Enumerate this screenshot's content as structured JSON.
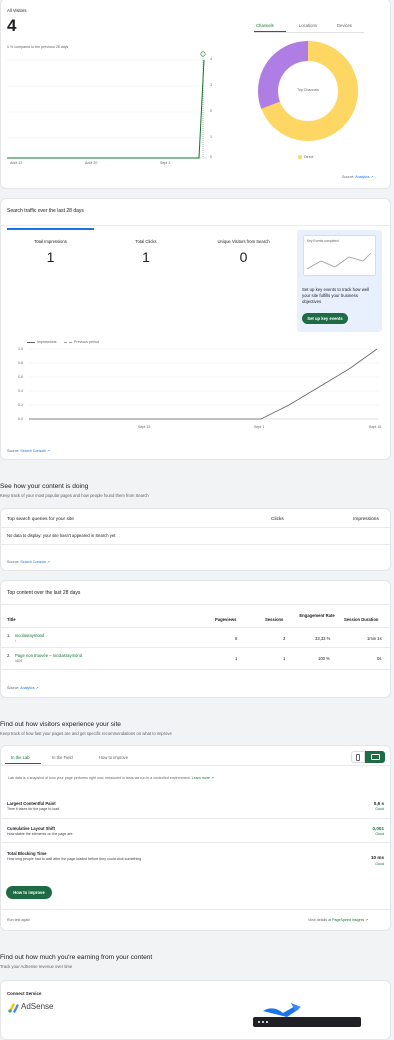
{
  "visitors": {
    "title": "All Visitors",
    "count": "4",
    "comparison": "0 % compared to the previous 28 days",
    "y_ticks": [
      "4",
      "3",
      "2",
      "1",
      "0"
    ],
    "x_ticks": [
      "Août 13",
      "Août 20",
      "Sept 3"
    ],
    "tabs": [
      "Channels",
      "Locations",
      "Devices"
    ],
    "donut_center": "Top Channels",
    "legend": "Direct",
    "source_label": "Source:",
    "source_link": "Analytics",
    "colors": {
      "direct": "#fdd663",
      "other": "#af7ee5",
      "line": "#137333",
      "accent": "#137333"
    }
  },
  "search_traffic": {
    "title": "Search traffic over the last 28 days",
    "metrics": [
      {
        "label": "Total Impressions",
        "value": "1"
      },
      {
        "label": "Total Clicks",
        "value": "1"
      },
      {
        "label": "Unique Visitors from Search",
        "value": "0"
      }
    ],
    "promo": {
      "thumb_title": "Key Events completed",
      "text": "Set up key events to track how well your site fulfills your business objectives",
      "button": "Set up key events"
    },
    "legend": [
      "Impressions",
      "Previous period"
    ],
    "y_ticks": [
      "1.0",
      "0.8",
      "0.6",
      "0.4",
      "0.2",
      "0.0"
    ],
    "x_ticks": [
      "Sept 15",
      "Sept 1",
      "Sept 15"
    ],
    "source_label": "Source:",
    "source_link": "Search Console"
  },
  "content_section": {
    "title": "See how your content is doing",
    "subtitle": "Keep track of your most popular pages and how people found them from Search"
  },
  "queries": {
    "title": "Top search queries for your site",
    "col_clicks": "Clicks",
    "col_impressions": "Impressions",
    "empty": "No data to display: your site hasn't appeared in Search yet",
    "source_label": "Source:",
    "source_link": "Search Console"
  },
  "top_content": {
    "title": "Top content over the last 28 days",
    "columns": [
      "Title",
      "Pageviews",
      "Sessions",
      "Engagement Rate",
      "Session Duration"
    ],
    "rows": [
      {
        "index": "1.",
        "title": "nicolasraymond",
        "path": "/",
        "pageviews": "6",
        "sessions": "3",
        "engagement": "33,33 %",
        "duration": "1min 1s"
      },
      {
        "index": "2.",
        "title": "Page non trouvée – nicolasraymond",
        "path": "/404",
        "pageviews": "1",
        "sessions": "1",
        "engagement": "100 %",
        "duration": "0s"
      }
    ],
    "source_label": "Source:",
    "source_link": "Analytics"
  },
  "experience": {
    "title": "Find out how visitors experience your site",
    "subtitle": "Keep track of how fast your pages are and get specific recommendations on what to improve",
    "tabs": [
      "In the Lab",
      "In the Field",
      "How to improve"
    ],
    "lab_text": "Lab data is a snapshot of how your page performs right now, measured in tests we run in a controlled environment.",
    "learn_more": "Learn more",
    "metrics": [
      {
        "name": "Largest Contentful Paint",
        "desc": "Time it takes for the page to load",
        "value": "0,6 s",
        "rating": "Good"
      },
      {
        "name": "Cumulative Layout Shift",
        "desc": "How stable the elements on the page are",
        "value": "0,001",
        "rating": "Good"
      },
      {
        "name": "Total Blocking Time",
        "desc": "How long people had to wait after the page loaded before they could click something",
        "value": "10 ms",
        "rating": "Good"
      }
    ],
    "button": "How to improve",
    "run_again": "Run test again",
    "view_details": "View details at",
    "pagespeed": "PageSpeed Insights"
  },
  "earnings": {
    "title": "Find out how much you're earning from your content",
    "subtitle": "Track your AdSense revenue over time",
    "connect": "Connect Service",
    "service": "AdSense"
  }
}
